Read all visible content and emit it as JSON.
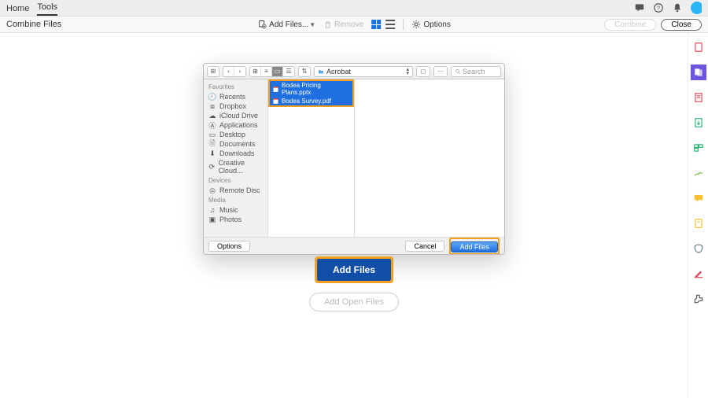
{
  "nav": {
    "home": "Home",
    "tools": "Tools"
  },
  "toolbar": {
    "title": "Combine Files",
    "add_files": "Add Files...",
    "remove": "Remove",
    "options": "Options",
    "combine": "Combine",
    "close": "Close"
  },
  "finder": {
    "location": "Acrobat",
    "search_placeholder": "Search",
    "sidebar": {
      "favorites": "Favorites",
      "items_fav": [
        "Recents",
        "Dropbox",
        "iCloud Drive",
        "Applications",
        "Desktop",
        "Documents",
        "Downloads",
        "Creative Cloud..."
      ],
      "devices": "Devices",
      "items_dev": [
        "Remote Disc"
      ],
      "media": "Media",
      "items_media": [
        "Music",
        "Photos"
      ]
    },
    "files": [
      "Bodea Pricing Plans.pptx",
      "Bodea Survey.pdf"
    ],
    "options_btn": "Options",
    "cancel": "Cancel",
    "add_files": "Add Files"
  },
  "center": {
    "add_files": "Add Files",
    "add_open_files": "Add Open Files"
  }
}
